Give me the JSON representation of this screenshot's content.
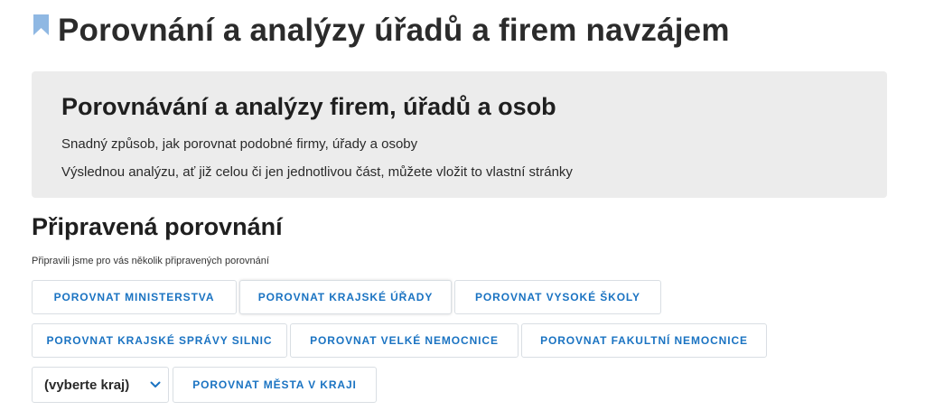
{
  "header": {
    "title": "Porovnání a analýzy úřadů a firem navzájem"
  },
  "hero": {
    "heading": "Porovnávání a analýzy firem, úřadů a osob",
    "line1": "Snadný způsob, jak porovnat podobné firmy, úřady a osoby",
    "line2": "Výslednou analýzu, ať již celou či jen jednotlivou část, můžete vložit to vlastní stránky"
  },
  "prepared": {
    "heading": "Připravená porovnání",
    "description": "Připravili jsme pro vás několik připravených porovnání",
    "buttons": [
      "POROVNAT MINISTERSTVA",
      "POROVNAT KRAJSKÉ ÚŘADY",
      "POROVNAT VYSOKÉ ŠKOLY",
      "POROVNAT KRAJSKÉ SPRÁVY SILNIC",
      "POROVNAT VELKÉ NEMOCNICE",
      "POROVNAT FAKULTNÍ NEMOCNICE"
    ],
    "region_select": {
      "selected": "(vyberte kraj)"
    },
    "cities_button": "POROVNAT MĚSTA V KRAJI"
  },
  "colors": {
    "accent": "#1a73c2",
    "bookmark": "#8fb8e3",
    "hero_bg": "#ececec"
  },
  "icons": {
    "bookmark": "bookmark-icon",
    "dropdown": "chevron-down-icon"
  }
}
